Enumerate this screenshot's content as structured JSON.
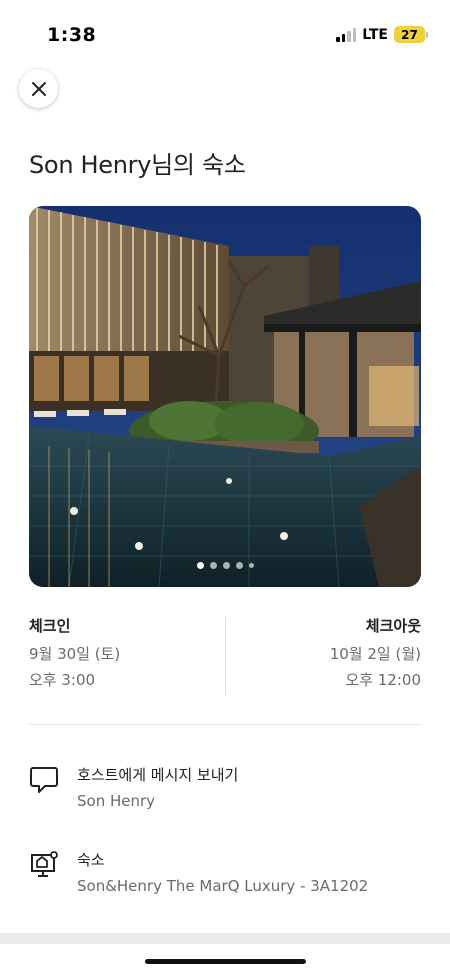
{
  "status_bar": {
    "time": "1:38",
    "network": "LTE",
    "battery": "27",
    "battery_color": "#f0cf3c"
  },
  "close_button": {
    "icon": "close-icon"
  },
  "page": {
    "title": "Son Henry님의 숙소"
  },
  "photo": {
    "description_icon": "listing-photo",
    "carousel_count": 5,
    "carousel_active_index": 0
  },
  "checkin": {
    "label": "체크인",
    "date": "9월 30일 (토)",
    "time": "오후 3:00"
  },
  "checkout": {
    "label": "체크아웃",
    "date": "10월 2일 (월)",
    "time": "오후 12:00"
  },
  "rows": [
    {
      "icon": "message-icon",
      "title": "호스트에게 메시지 보내기",
      "subtitle": "Son Henry"
    },
    {
      "icon": "house-icon",
      "title": "숙소",
      "subtitle": "Son&Henry The MarQ Luxury - 3A1202"
    }
  ]
}
